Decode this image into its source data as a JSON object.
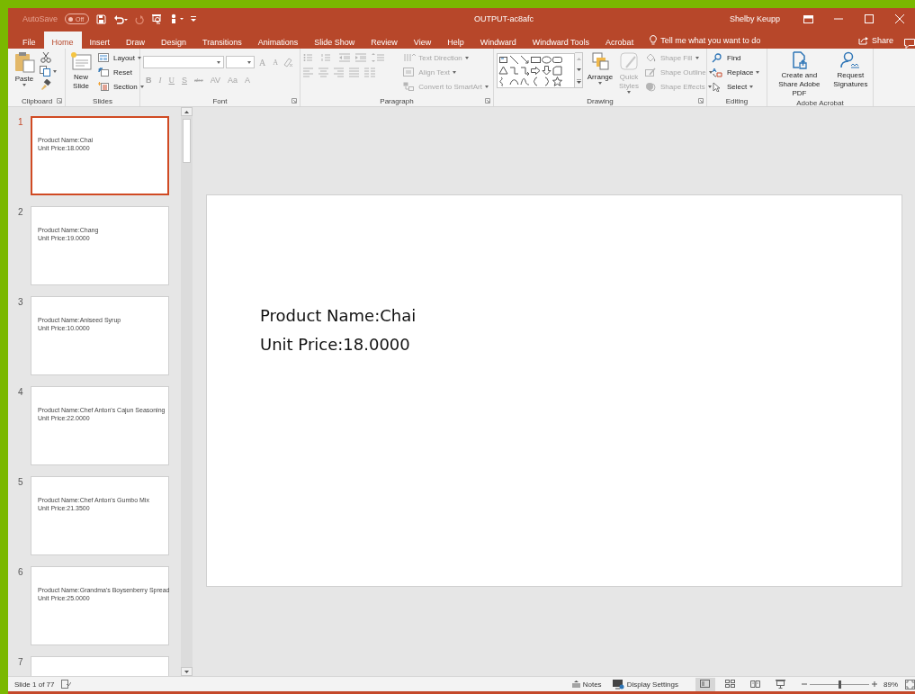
{
  "title_bar": {
    "autosave": {
      "label": "AutoSave",
      "state": "Off",
      "on": false
    },
    "title": "OUTPUT-ac8afc",
    "user": "Shelby Keupp"
  },
  "tabs": [
    {
      "label": "File",
      "selected": false
    },
    {
      "label": "Home",
      "selected": true
    },
    {
      "label": "Insert",
      "selected": false
    },
    {
      "label": "Draw",
      "selected": false
    },
    {
      "label": "Design",
      "selected": false
    },
    {
      "label": "Transitions",
      "selected": false
    },
    {
      "label": "Animations",
      "selected": false
    },
    {
      "label": "Slide Show",
      "selected": false
    },
    {
      "label": "Review",
      "selected": false
    },
    {
      "label": "View",
      "selected": false
    },
    {
      "label": "Help",
      "selected": false
    },
    {
      "label": "Windward",
      "selected": false
    },
    {
      "label": "Windward Tools",
      "selected": false
    },
    {
      "label": "Acrobat",
      "selected": false
    }
  ],
  "tell_me": "Tell me what you want to do",
  "share": "Share",
  "ribbon": [
    {
      "kind": "clipboard",
      "label": "Clipboard",
      "launcher": true,
      "paste": {
        "label": "Paste",
        "disabled": false
      }
    },
    {
      "kind": "slides",
      "label": "Slides",
      "new_slide": {
        "label": "New Slide",
        "disabled": false
      },
      "commands": [
        {
          "kind": "layout",
          "label": "Layout",
          "dropdown": true,
          "disabled": false
        },
        {
          "kind": "reset",
          "label": "Reset",
          "dropdown": false,
          "disabled": false
        },
        {
          "kind": "section",
          "label": "Section",
          "dropdown": true,
          "disabled": false
        }
      ]
    },
    {
      "kind": "font",
      "label": "Font",
      "launcher": true,
      "disabled": true,
      "size_buttons": [
        {
          "text": "A",
          "kind": "grow"
        },
        {
          "text": "A",
          "kind": "shrink"
        }
      ],
      "format_buttons": [
        {
          "text": "B",
          "kind": "bold"
        },
        {
          "text": "I",
          "kind": "italic"
        },
        {
          "text": "U",
          "kind": "underline"
        },
        {
          "text": "S",
          "kind": "shadow"
        },
        {
          "text": "abc",
          "kind": "strike"
        },
        {
          "text": "AV",
          "kind": "spacing"
        },
        {
          "text": "Aa",
          "kind": "case"
        },
        {
          "text": "A",
          "kind": "color"
        }
      ]
    },
    {
      "kind": "paragraph",
      "label": "Paragraph",
      "launcher": true,
      "disabled": true,
      "commands": [
        {
          "kind": "direction",
          "label": "Text Direction",
          "dropdown": true,
          "disabled": true
        },
        {
          "kind": "align",
          "label": "Align Text",
          "dropdown": true,
          "disabled": true
        },
        {
          "kind": "smartart",
          "label": "Convert to SmartArt",
          "dropdown": true,
          "disabled": true
        }
      ]
    },
    {
      "kind": "drawing",
      "label": "Drawing",
      "launcher": true,
      "arrange": {
        "label": "Arrange",
        "disabled": false
      },
      "quick_styles": {
        "label": "Quick Styles",
        "disabled": true
      },
      "commands": [
        {
          "kind": "fill",
          "label": "Shape Fill",
          "dropdown": true,
          "disabled": true
        },
        {
          "kind": "outline",
          "label": "Shape Outline",
          "dropdown": true,
          "disabled": true
        },
        {
          "kind": "effects",
          "label": "Shape Effects",
          "dropdown": true,
          "disabled": true
        }
      ]
    },
    {
      "kind": "editing",
      "label": "Editing",
      "commands": [
        {
          "kind": "find",
          "label": "Find",
          "dropdown": false,
          "disabled": false
        },
        {
          "kind": "replace",
          "label": "Replace",
          "dropdown": true,
          "disabled": false
        },
        {
          "kind": "select",
          "label": "Select",
          "dropdown": true,
          "disabled": false
        }
      ]
    },
    {
      "kind": "acrobat",
      "label": "Adobe Acrobat",
      "buttons": [
        {
          "kind": "create_pdf",
          "label": "Create and Share Adobe PDF",
          "disabled": false
        },
        {
          "kind": "signatures",
          "label": "Request Signatures",
          "disabled": false
        }
      ]
    }
  ],
  "slides": [
    {
      "number": "1",
      "selected": true,
      "lines": [
        "Product Name:Chai",
        "Unit Price:18.0000"
      ]
    },
    {
      "number": "2",
      "selected": false,
      "lines": [
        "Product Name:Chang",
        "Unit Price:19.0000"
      ]
    },
    {
      "number": "3",
      "selected": false,
      "lines": [
        "Product Name:Aniseed Syrup",
        "Unit Price:10.0000"
      ]
    },
    {
      "number": "4",
      "selected": false,
      "lines": [
        "Product Name:Chef Anton's Cajun Seasoning",
        "Unit Price:22.0000"
      ]
    },
    {
      "number": "5",
      "selected": false,
      "lines": [
        "Product Name:Chef Anton's Gumbo Mix",
        "Unit Price:21.3500"
      ]
    },
    {
      "number": "6",
      "selected": false,
      "lines": [
        "Product Name:Grandma's Boysenberry Spread",
        "Unit Price:25.0000"
      ]
    },
    {
      "number": "7",
      "selected": false
    }
  ],
  "current_slide": {
    "lines": [
      "Product Name:Chai",
      "Unit Price:18.0000"
    ]
  },
  "status_bar": {
    "slide_counter": "Slide 1 of 77",
    "notes": "Notes",
    "display_settings": "Display Settings",
    "views": [
      {
        "kind": "normal",
        "selected": true
      },
      {
        "kind": "sorter",
        "selected": false
      },
      {
        "kind": "reading",
        "selected": false
      },
      {
        "kind": "slideshow",
        "selected": false
      }
    ],
    "zoom": {
      "level": 0.5,
      "reading": "89%"
    }
  }
}
